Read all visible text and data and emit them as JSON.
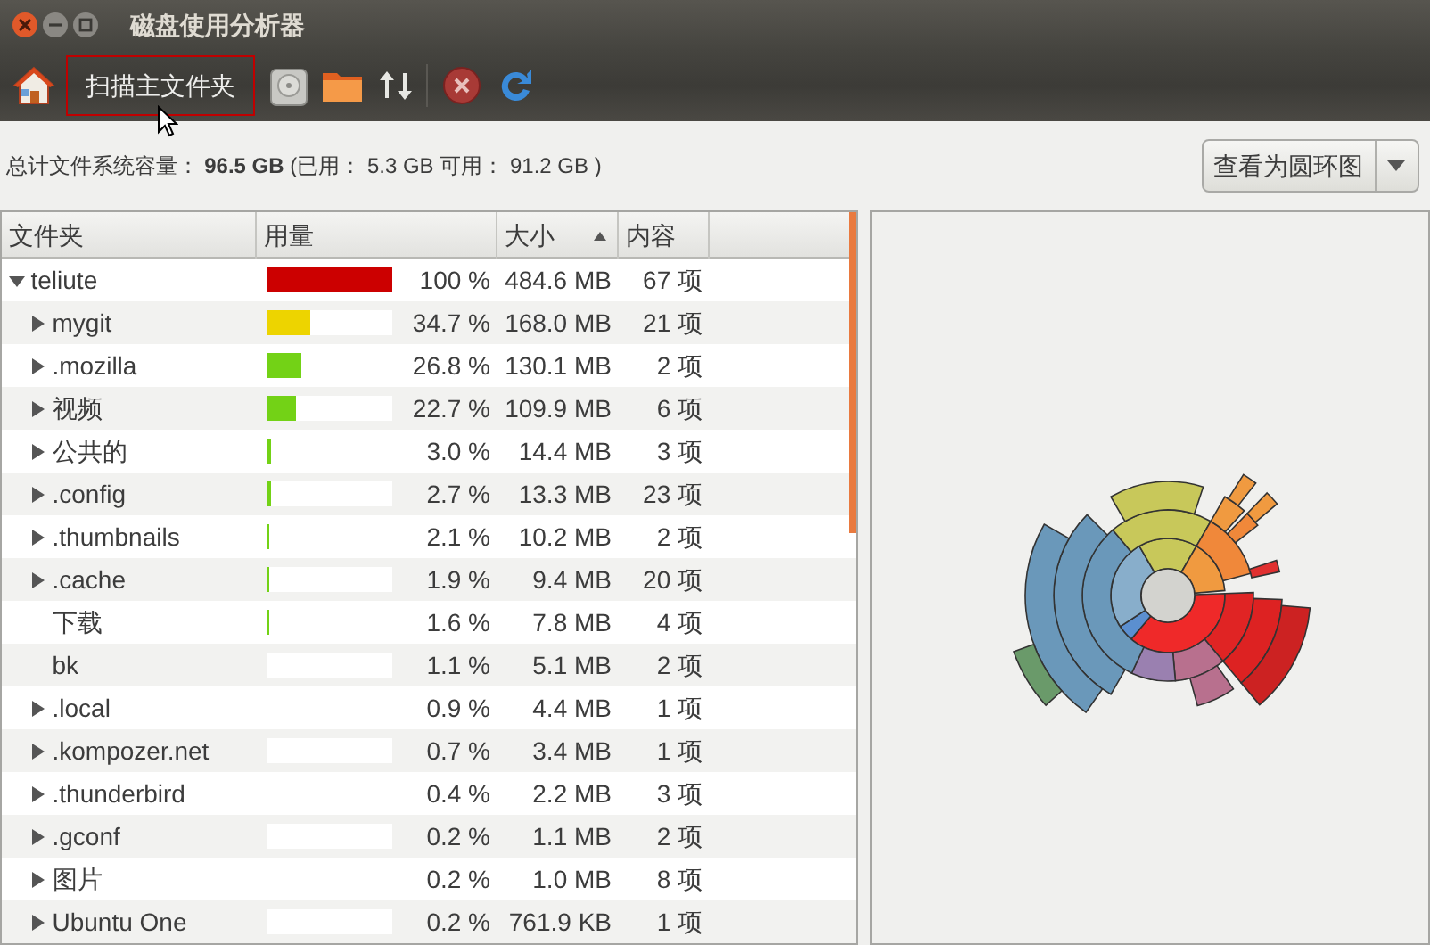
{
  "window": {
    "title": "磁盘使用分析器"
  },
  "toolbar": {
    "scan_home_button": {
      "label": "扫描主文件夹",
      "hovered": true
    }
  },
  "summary": "总计文件系统容量： **96.5 GB** (已用： 5.3 GB 可用： 91.2 GB )",
  "view_button": {
    "label": "查看为圆环图"
  },
  "table": {
    "columns": [
      {
        "label": "文件夹",
        "sorted": false
      },
      {
        "label": "用量",
        "sorted": false
      },
      {
        "label": "大小",
        "sorted": true
      },
      {
        "label": "内容",
        "sorted": false
      }
    ],
    "rows": [
      {
        "name": "teliute",
        "percent": "100 %",
        "size": "484.6 MB",
        "contents": "67 项",
        "level": 1.0,
        "color": "#cc0000",
        "kind": "expandable",
        "expanded": true,
        "children": [
          {
            "name": "mygit",
            "percent": "34.7 %",
            "size": "168.0 MB",
            "contents": "21 项",
            "level": 0.347,
            "color": "#edd400",
            "kind": "expandable",
            "expanded": false
          },
          {
            "name": ".mozilla",
            "percent": "26.8 %",
            "size": "130.1 MB",
            "contents": "2 项",
            "level": 0.268,
            "color": "#73d216",
            "kind": "expandable",
            "expanded": false
          },
          {
            "name": "视频",
            "percent": "22.7 %",
            "size": "109.9 MB",
            "contents": "6 项",
            "level": 0.227,
            "color": "#73d216",
            "kind": "expandable",
            "expanded": false
          },
          {
            "name": "公共的",
            "percent": "3.0 %",
            "size": "14.4 MB",
            "contents": "3 项",
            "level": 0.03,
            "color": "#73d216",
            "kind": "expandable",
            "expanded": false
          },
          {
            "name": ".config",
            "percent": "2.7 %",
            "size": "13.3 MB",
            "contents": "23 项",
            "level": 0.027,
            "color": "#73d216",
            "kind": "expandable",
            "expanded": false
          },
          {
            "name": ".thumbnails",
            "percent": "2.1 %",
            "size": "10.2 MB",
            "contents": "2 项",
            "level": 0.021,
            "color": "#73d216",
            "kind": "expandable",
            "expanded": false
          },
          {
            "name": ".cache",
            "percent": "1.9 %",
            "size": "9.4 MB",
            "contents": "20 项",
            "level": 0.019,
            "color": "#73d216",
            "kind": "expandable",
            "expanded": false
          },
          {
            "name": "下载",
            "percent": "1.6 %",
            "size": "7.8 MB",
            "contents": "4 项",
            "level": 0.016,
            "color": "#73d216",
            "kind": "leaf"
          },
          {
            "name": "bk",
            "percent": "1.1 %",
            "size": "5.1 MB",
            "contents": "2 项",
            "kind": "leaf"
          },
          {
            "name": ".local",
            "percent": "0.9 %",
            "size": "4.4 MB",
            "contents": "1 项",
            "kind": "expandable",
            "expanded": false
          },
          {
            "name": ".kompozer.net",
            "percent": "0.7 %",
            "size": "3.4 MB",
            "contents": "1 项",
            "kind": "expandable",
            "expanded": false
          },
          {
            "name": ".thunderbird",
            "percent": "0.4 %",
            "size": "2.2 MB",
            "contents": "3 项",
            "kind": "expandable",
            "expanded": false
          },
          {
            "name": ".gconf",
            "percent": "0.2 %",
            "size": "1.1 MB",
            "contents": "2 项",
            "kind": "expandable",
            "expanded": false
          },
          {
            "name": "图片",
            "percent": "0.2 %",
            "size": "1.0 MB",
            "contents": "8 项",
            "kind": "expandable",
            "expanded": false
          },
          {
            "name": "Ubuntu One",
            "percent": "0.2 %",
            "size": "761.9 KB",
            "contents": "1 项",
            "kind": "expandable",
            "expanded": false
          }
        ]
      }
    ]
  }
}
